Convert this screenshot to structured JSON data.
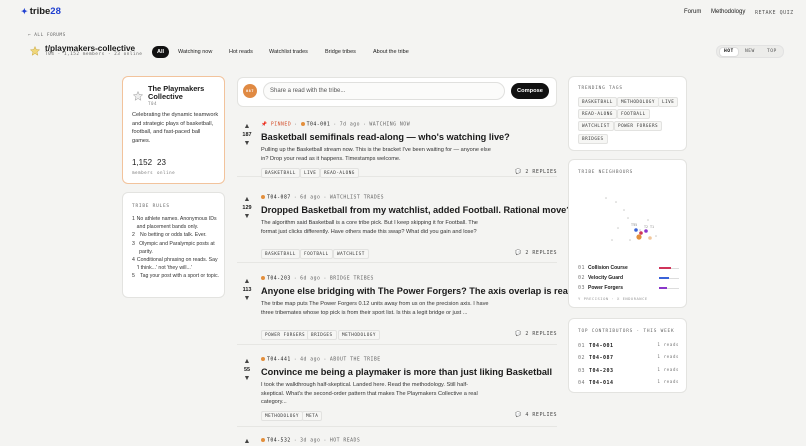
{
  "nav": {
    "logo_prefix": "tribe",
    "logo_suffix": "28",
    "links": [
      "Forum",
      "Methodology"
    ],
    "theme_toggle": "RETAKE QUIZ"
  },
  "back_link": "← ALL FORUMS",
  "forum": {
    "name": "t/playmakers-collective",
    "stats": "T04 · 1,152 members · 23 online"
  },
  "tabs": [
    "All",
    "Watching now",
    "Hot reads",
    "Watchlist trades",
    "Bridge tribes",
    "About the tribe"
  ],
  "sort": [
    "HOT",
    "NEW",
    "TOP"
  ],
  "about": {
    "name": "The Playmakers Collective",
    "tier": "T04",
    "description": "Celebrating the dynamic teamwork and strategic plays of basketball, football, and fast-paced ball games.",
    "members_value": "1,152",
    "members_label": "members",
    "online_value": "23",
    "online_label": "online"
  },
  "rules": {
    "heading": "TRIBE RULES",
    "items": [
      "No athlete names. Anonymous IDs and placement bands only.",
      "No betting or odds talk. Ever.",
      "Olympic and Paralympic posts at parity.",
      "Conditional phrasing on reads. Say 'I think...' not 'they will...'",
      "Tag your post with a sport or topic."
    ]
  },
  "composer": {
    "avatar": "087",
    "placeholder": "Share a read with the tribe...",
    "button": "Compose"
  },
  "posts": [
    {
      "pinned": "PINNED",
      "author": "T04-001",
      "time": "7d ago",
      "category": "WATCHING NOW",
      "votes": "187",
      "title": "Basketball semifinals read-along — who's watching live?",
      "body": "Pulling up the Basketball stream now. This is the bracket I've been waiting for — anyone else in? Drop your read as it happens. Timestamps welcome.",
      "tags": [
        "BASKETBALL",
        "LIVE",
        "READ-ALONG"
      ],
      "replies": "2 REPLIES"
    },
    {
      "pinned": "",
      "author": "T04-087",
      "time": "6d ago",
      "category": "WATCHLIST TRADES",
      "votes": "129",
      "title": "Dropped Basketball from my watchlist, added Football. Rational move?",
      "body": "The algorithm said Basketball is a core tribe pick. But I keep skipping it for Football. The format just clicks differently. Have others made this swap? What did you gain and lose?",
      "tags": [
        "BASKETBALL",
        "FOOTBALL",
        "WATCHLIST"
      ],
      "replies": "2 REPLIES"
    },
    {
      "pinned": "",
      "author": "T04-203",
      "time": "6d ago",
      "category": "BRIDGE TRIBES",
      "votes": "113",
      "title": "Anyone else bridging with The Power Forgers? The axis overlap is real.",
      "body": "The tribe map puts The Power Forgers 0.12 units away from us on the precision axis. I have three tribemates whose top pick is from their sport list. Is this a legit bridge or just ...",
      "tags": [
        "POWER FORGERS",
        "BRIDGES",
        "METHODOLOGY"
      ],
      "replies": "2 REPLIES"
    },
    {
      "pinned": "",
      "author": "T04-441",
      "time": "4d ago",
      "category": "ABOUT THE TRIBE",
      "votes": "55",
      "title": "Convince me being a playmaker is more than just liking Basketball",
      "body": "I took the walkthrough half-skeptical. Landed here. Read the methodology. Still half-skeptical. What's the second-order pattern that makes The Playmakers Collective a real category...",
      "tags": [
        "METHODOLOGY",
        "META"
      ],
      "replies": "4 REPLIES"
    },
    {
      "pinned": "",
      "author": "T04-532",
      "time": "3d ago",
      "category": "HOT READS",
      "votes": "",
      "title": "",
      "body": "",
      "tags": [],
      "replies": ""
    }
  ],
  "trending": {
    "heading": "TRENDING TAGS",
    "tags": [
      "BASKETBALL",
      "METHODOLOGY",
      "LIVE",
      "READ-ALONG",
      "FOOTBALL",
      "WATCHLIST",
      "POWER FORGERS",
      "BRIDGES"
    ]
  },
  "neighbours": {
    "heading": "TRIBE NEIGHBOURS",
    "map_labels": [
      "T15",
      "T2",
      "T1"
    ],
    "list": [
      {
        "rank": "01",
        "name": "Collision Course",
        "color": "#d0345a"
      },
      {
        "rank": "02",
        "name": "Velocity Guard",
        "color": "#3a63d8"
      },
      {
        "rank": "03",
        "name": "Power Forgers",
        "color": "#8a36c9"
      }
    ],
    "footer": "Y PRECISION · X ENDURANCE"
  },
  "contributors": {
    "heading": "TOP CONTRIBUTORS · THIS WEEK",
    "rows": [
      {
        "rank": "01",
        "id": "T04-001",
        "reads": "1 reads"
      },
      {
        "rank": "02",
        "id": "T04-087",
        "reads": "1 reads"
      },
      {
        "rank": "03",
        "id": "T04-203",
        "reads": "1 reads"
      },
      {
        "rank": "04",
        "id": "T04-014",
        "reads": "1 reads"
      }
    ]
  },
  "colors": {
    "accent": "#1f3fd0",
    "orange": "#e38f3c",
    "ink": "#111111"
  }
}
